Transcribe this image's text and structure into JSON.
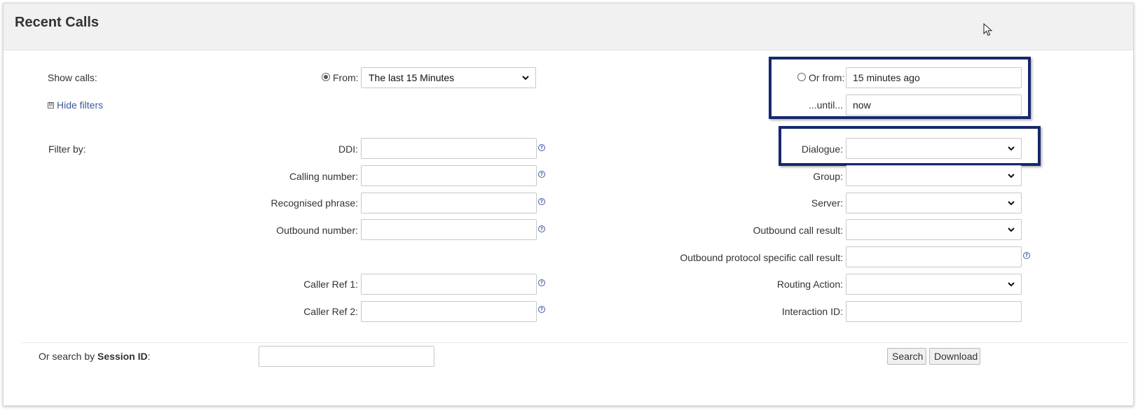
{
  "page": {
    "title": "Recent Calls"
  },
  "time": {
    "show_calls_label": "Show calls:",
    "from_label": "From:",
    "from_value": "The last 15 Minutes",
    "or_from_label": "Or from:",
    "or_from_value": "15 minutes ago",
    "until_label": "...until...",
    "until_value": "now",
    "hide_filters_symbol": "⊟",
    "hide_filters_label": "Hide filters"
  },
  "filters": {
    "filter_by_label": "Filter by:",
    "left": [
      {
        "label": "DDI:",
        "value": ""
      },
      {
        "label": "Calling number:",
        "value": ""
      },
      {
        "label": "Recognised phrase:",
        "value": ""
      },
      {
        "label": "Outbound number:",
        "value": ""
      },
      {
        "label": "Caller Ref 1:",
        "value": ""
      },
      {
        "label": "Caller Ref 2:",
        "value": ""
      }
    ],
    "right": [
      {
        "label": "Dialogue:",
        "value": ""
      },
      {
        "label": "Group:",
        "value": ""
      },
      {
        "label": "Server:",
        "value": ""
      },
      {
        "label": "Outbound call result:",
        "value": ""
      },
      {
        "label": "Outbound protocol specific call result:",
        "value": ""
      },
      {
        "label": "Routing Action:",
        "value": ""
      },
      {
        "label": "Interaction ID:",
        "value": ""
      }
    ],
    "help_glyph": "?"
  },
  "session": {
    "prefix": "Or search by ",
    "bold": "Session ID",
    "suffix": ":",
    "value": ""
  },
  "buttons": {
    "search": "Search",
    "download": "Download"
  },
  "colors": {
    "highlight": "#16286d",
    "link": "#3a5a9c",
    "header_bg": "#f1f1f1"
  }
}
